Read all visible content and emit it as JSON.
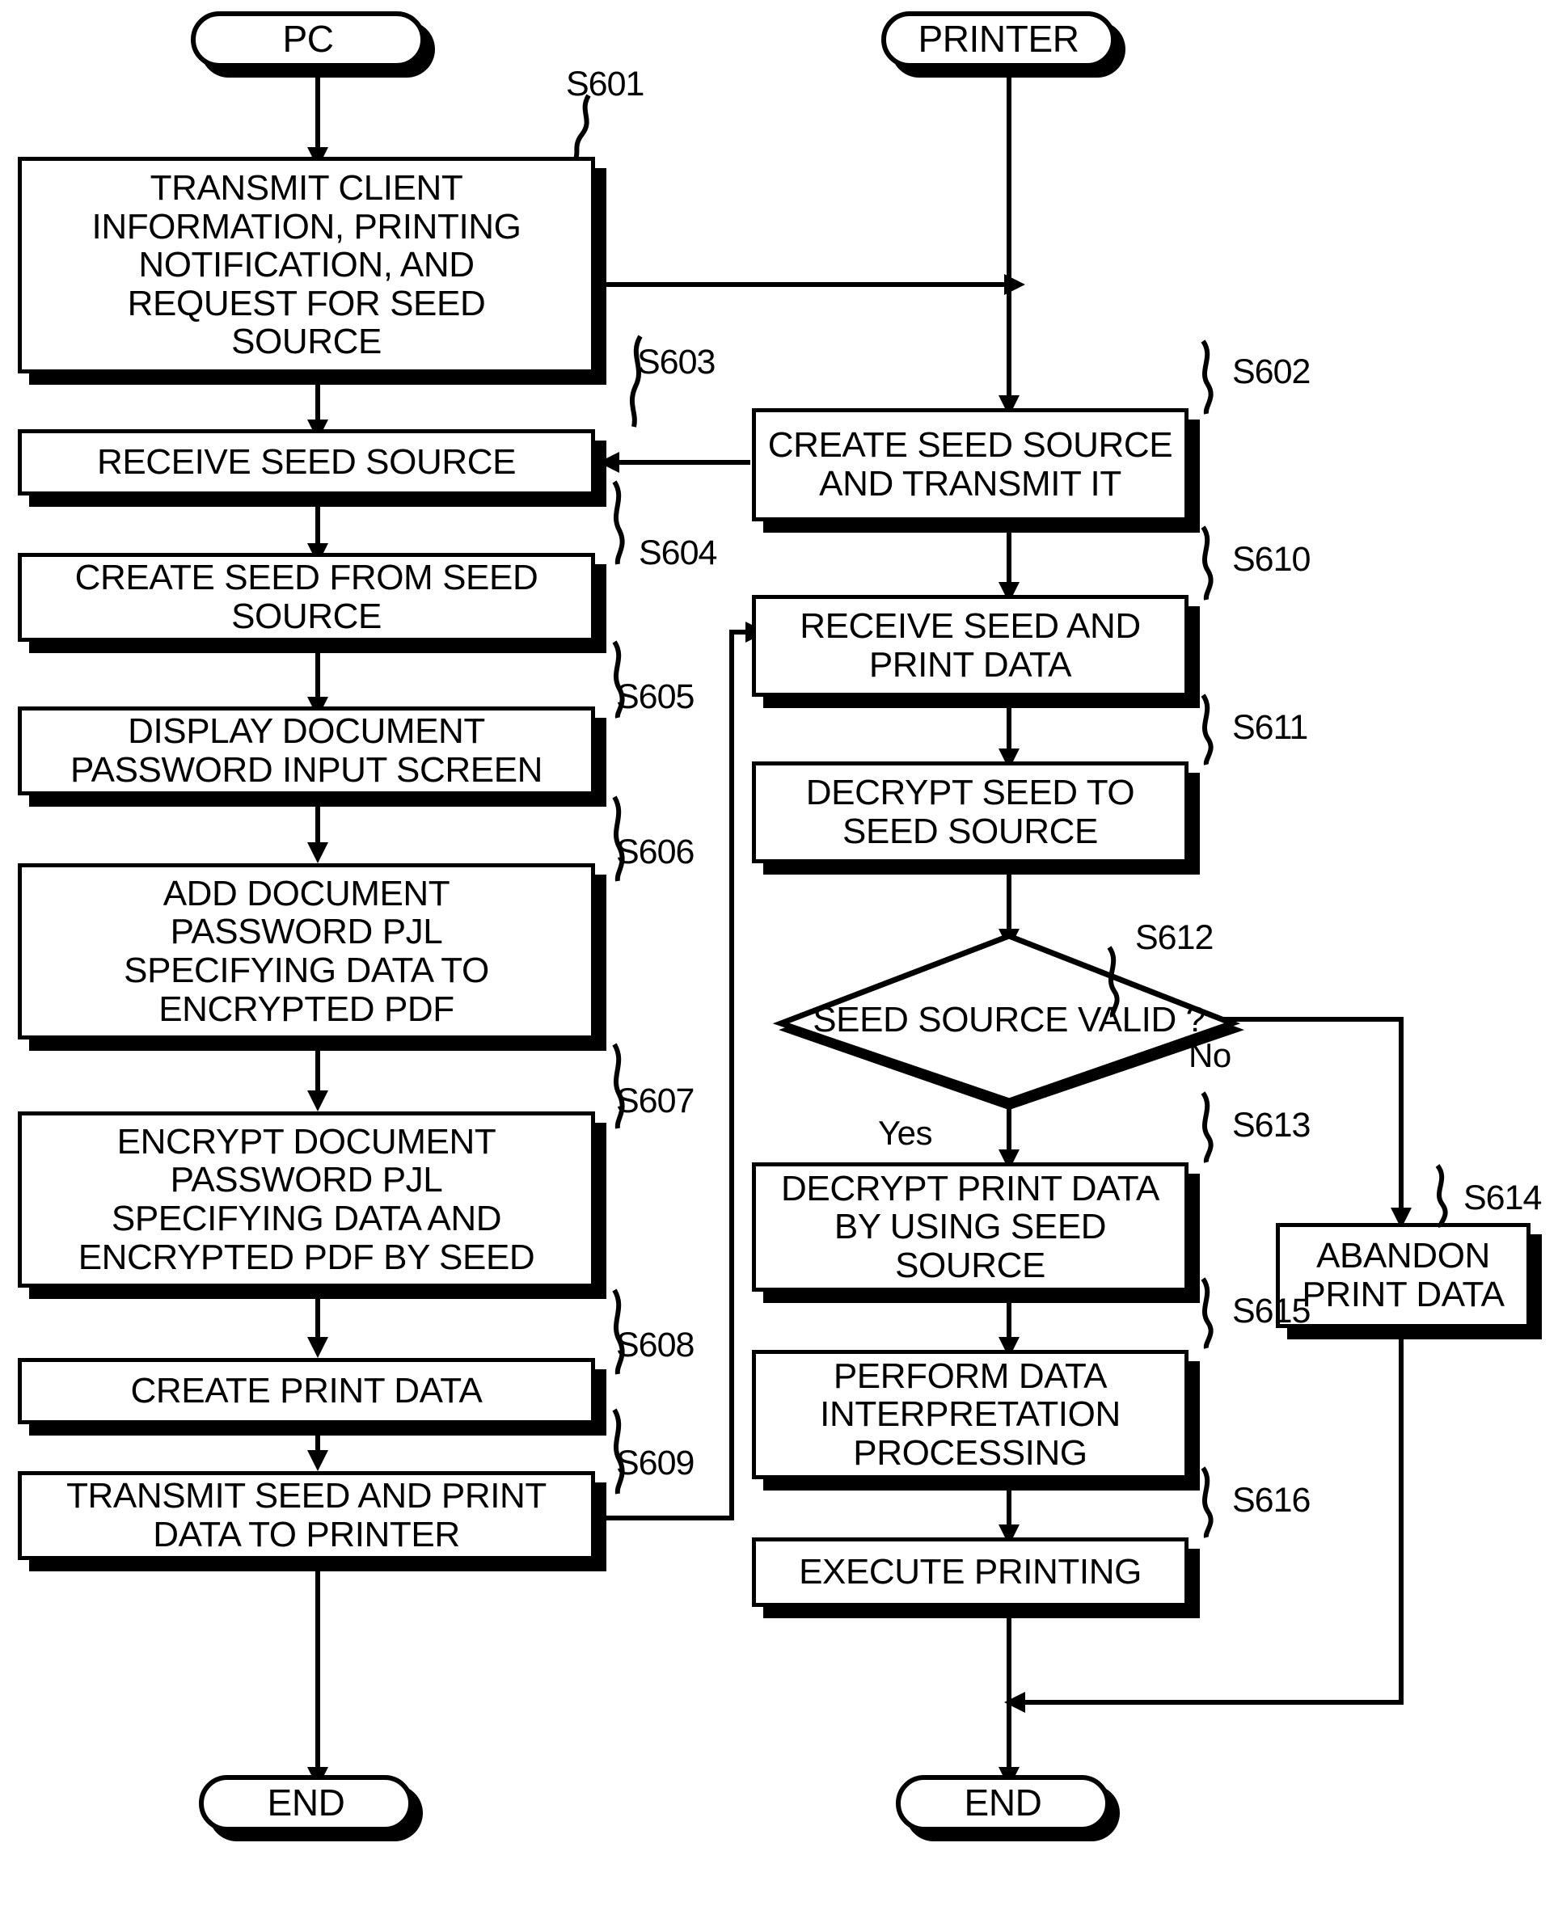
{
  "diagram": {
    "title": "Printing sequence flowchart (PC / Printer)",
    "terminals": [
      {
        "id": "pc",
        "label": "PC"
      },
      {
        "id": "printer",
        "label": "PRINTER"
      },
      {
        "id": "end_left",
        "label": "END"
      },
      {
        "id": "end_right",
        "label": "END"
      }
    ],
    "steps": [
      {
        "ref": "S601",
        "label": "TRANSMIT CLIENT\nINFORMATION, PRINTING\nNOTIFICATION, AND\nREQUEST FOR SEED\nSOURCE"
      },
      {
        "ref": "S602",
        "label": "CREATE SEED SOURCE\nAND TRANSMIT IT"
      },
      {
        "ref": "S603",
        "label": "RECEIVE SEED SOURCE"
      },
      {
        "ref": "S604",
        "label": "CREATE SEED FROM SEED\nSOURCE"
      },
      {
        "ref": "S605",
        "label": "DISPLAY DOCUMENT\nPASSWORD INPUT SCREEN"
      },
      {
        "ref": "S606",
        "label": "ADD DOCUMENT\nPASSWORD PJL\nSPECIFYING DATA TO\nENCRYPTED PDF"
      },
      {
        "ref": "S607",
        "label": "ENCRYPT DOCUMENT\nPASSWORD PJL\nSPECIFYING DATA AND\nENCRYPTED PDF BY SEED"
      },
      {
        "ref": "S608",
        "label": "CREATE PRINT DATA"
      },
      {
        "ref": "S609",
        "label": "TRANSMIT SEED AND PRINT\nDATA TO PRINTER"
      },
      {
        "ref": "S610",
        "label": "RECEIVE SEED AND\nPRINT DATA"
      },
      {
        "ref": "S611",
        "label": "DECRYPT SEED TO\nSEED SOURCE"
      },
      {
        "ref": "S612",
        "label": "SEED\nSOURCE VALID\n?"
      },
      {
        "ref": "S613",
        "label": "DECRYPT PRINT DATA\nBY USING SEED\nSOURCE"
      },
      {
        "ref": "S614",
        "label": "ABANDON\nPRINT DATA"
      },
      {
        "ref": "S615",
        "label": "PERFORM DATA\nINTERPRETATION\nPROCESSING"
      },
      {
        "ref": "S616",
        "label": "EXECUTE PRINTING"
      }
    ],
    "branch_labels": {
      "yes": "Yes",
      "no": "No"
    },
    "colors": {
      "ink": "#000000",
      "paper": "#ffffff"
    }
  }
}
